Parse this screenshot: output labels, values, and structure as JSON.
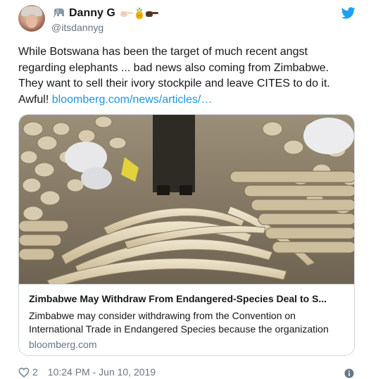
{
  "user": {
    "display_name": "Danny G",
    "handle": "@itsdannyg",
    "name_emojis": [
      "elephant",
      "hand-pointing-right",
      "pineapple",
      "hand-pointing-right-dark"
    ]
  },
  "tweet": {
    "text": "While Botswana has been the target of much recent angst regarding elephants ... bad news also coming from Zimbabwe. They want to sell their ivory stockpile and leave CITES to do it. Awful! ",
    "link_text": "bloomberg.com/news/articles/…"
  },
  "card": {
    "image_description_icon": "ivory-stockpile-photo",
    "title": "Zimbabwe May Withdraw From Endangered-Species Deal to S...",
    "description": "Zimbabwe may consider withdrawing from the Convention on International Trade in Endangered Species because the organization",
    "domain": "bloomberg.com"
  },
  "footer": {
    "like_count": "2",
    "timestamp": "10:24 PM - Jun 10, 2019"
  },
  "colors": {
    "link": "#1b95e0",
    "secondary_text": "#657786",
    "border": "#ccd6dd",
    "twitter_blue": "#1da1f2"
  }
}
